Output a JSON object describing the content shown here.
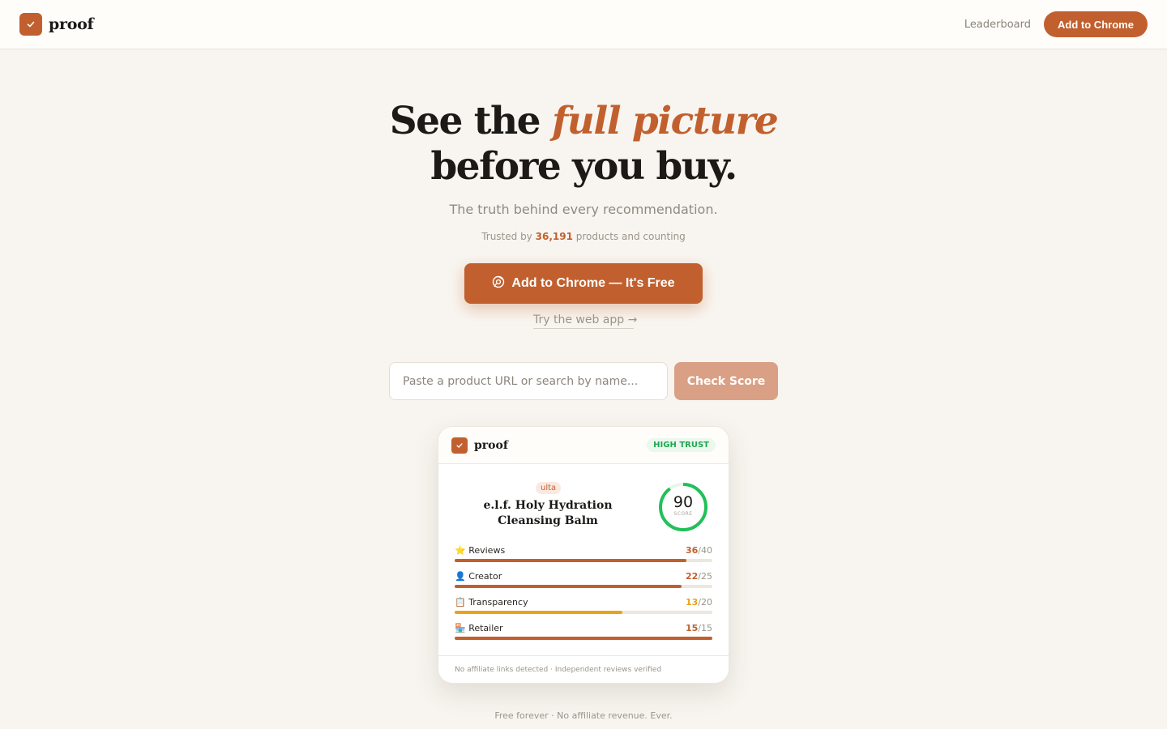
{
  "header": {
    "brand": "proof",
    "nav_link": "Leaderboard",
    "cta_label": "Add to Chrome"
  },
  "hero": {
    "title_prefix": "See the",
    "title_accent": "full picture",
    "title_line2": "before you buy.",
    "subtitle": "The truth behind every recommendation.",
    "trusted_prefix": "Trusted by",
    "trusted_count": "36,191",
    "trusted_suffix": "products and counting",
    "cta_label": "Add to Chrome — It's Free",
    "webapp_link": "Try the web app →"
  },
  "search": {
    "placeholder": "Paste a product URL or search by name...",
    "button_label": "Check Score"
  },
  "card": {
    "brand": "proof",
    "badge": "HIGH TRUST",
    "retailer": "ulta",
    "product_line1": "e.l.f. Holy Hydration",
    "product_line2": "Cleansing Balm",
    "score": "90",
    "score_label": "SCORE",
    "metrics": [
      {
        "icon": "⭐",
        "label": "Reviews",
        "got": "36",
        "max": "/40",
        "fraction": 0.9,
        "color": "#c1602e"
      },
      {
        "icon": "👤",
        "label": "Creator",
        "got": "22",
        "max": "/25",
        "fraction": 0.88,
        "color": "#c1602e"
      },
      {
        "icon": "📋",
        "label": "Transparency",
        "got": "13",
        "max": "/20",
        "fraction": 0.65,
        "color": "#e8a417"
      },
      {
        "icon": "🏪",
        "label": "Retailer",
        "got": "15",
        "max": "/15",
        "fraction": 1.0,
        "color": "#c1602e"
      }
    ],
    "footer": "No affiliate links detected · Independent reviews verified"
  },
  "footer_note": "Free forever · No affiliate revenue. Ever.",
  "colors": {
    "accent": "#c1602e",
    "success": "#21a84f",
    "warning": "#e8a417"
  }
}
